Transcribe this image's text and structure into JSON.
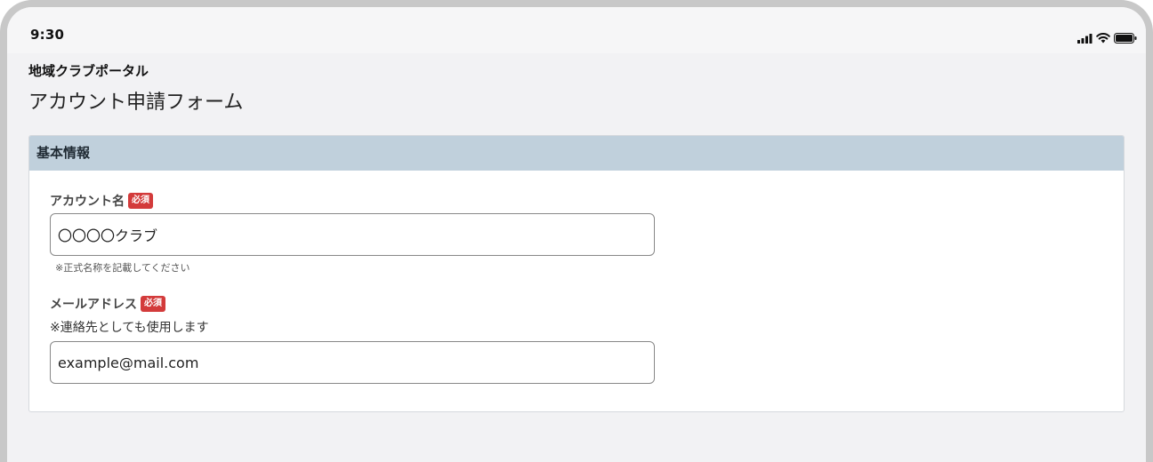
{
  "status_bar": {
    "time": "9:30",
    "icons": [
      "signal-icon",
      "wifi-icon",
      "battery-icon"
    ]
  },
  "app": {
    "name": "地域クラブポータル",
    "page_title": "アカウント申請フォーム"
  },
  "section": {
    "title": "基本情報"
  },
  "fields": {
    "account_name": {
      "label": "アカウント名",
      "required_badge": "必須",
      "value": "〇〇〇〇クラブ",
      "note": "※正式名称を記載してください"
    },
    "email": {
      "label": "メールアドレス",
      "required_badge": "必須",
      "note": "※連絡先としても使用します",
      "value": "example@mail.com"
    }
  },
  "colors": {
    "section_header_bg": "#c0d0dc",
    "required_badge_bg": "#d33b3b",
    "page_bg": "#f2f2f4"
  }
}
